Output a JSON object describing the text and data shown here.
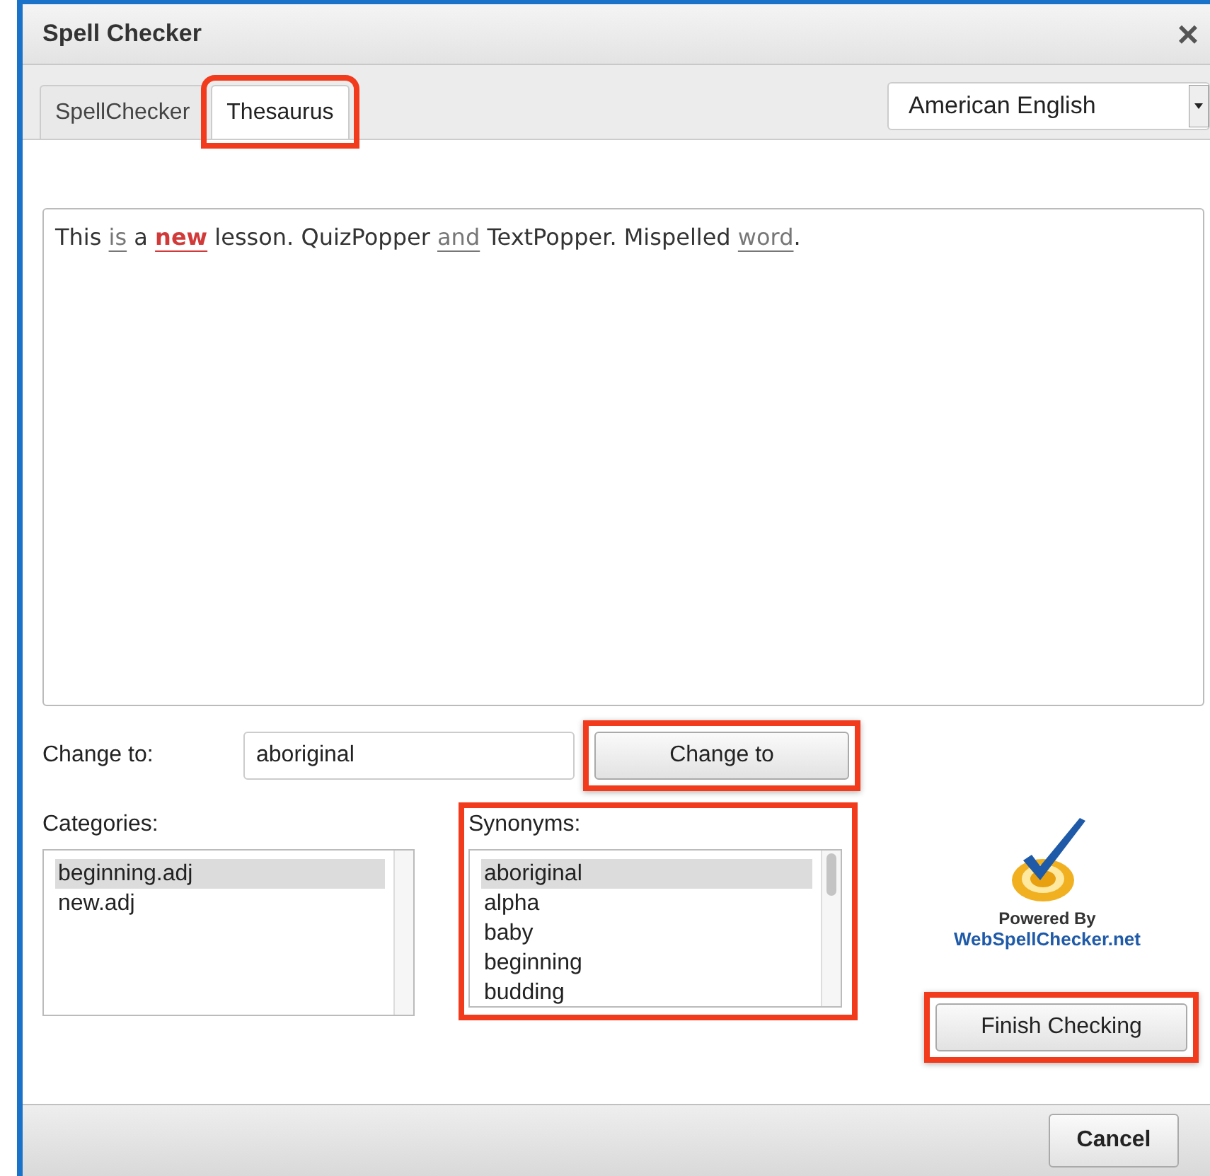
{
  "window": {
    "title": "Spell Checker",
    "close": "×"
  },
  "tabs": [
    {
      "label": "SpellChecker",
      "selected": false,
      "highlighted": false
    },
    {
      "label": "Thesaurus",
      "selected": true,
      "highlighted": true
    }
  ],
  "language_select": {
    "value": "American English"
  },
  "text_area": {
    "segments": [
      {
        "text": "This ",
        "kind": "plain"
      },
      {
        "text": "is",
        "kind": "grammar"
      },
      {
        "text": " a ",
        "kind": "plain"
      },
      {
        "text": "new",
        "kind": "misspelled"
      },
      {
        "text": " lesson. QuizPopper ",
        "kind": "plain"
      },
      {
        "text": "and",
        "kind": "grammar"
      },
      {
        "text": " TextPopper. Mispelled ",
        "kind": "plain"
      },
      {
        "text": "word",
        "kind": "grammar"
      },
      {
        "text": ".",
        "kind": "plain"
      }
    ]
  },
  "change_to": {
    "label": "Change to:",
    "value": "aboriginal",
    "button": "Change to",
    "highlighted": true
  },
  "categories": {
    "label": "Categories:",
    "items": [
      {
        "text": "beginning.adj",
        "selected": true
      },
      {
        "text": "new.adj",
        "selected": false
      }
    ]
  },
  "synonyms": {
    "label": "Synonyms:",
    "highlighted": true,
    "items": [
      {
        "text": "aboriginal",
        "selected": true
      },
      {
        "text": "alpha",
        "selected": false
      },
      {
        "text": "baby",
        "selected": false
      },
      {
        "text": "beginning",
        "selected": false
      },
      {
        "text": "budding",
        "selected": false
      }
    ]
  },
  "logo": {
    "line_1": "Powered By",
    "line_2": "WebSpellChecker.net"
  },
  "finish_button": {
    "label": "Finish Checking",
    "highlighted": true
  },
  "footer": {
    "cancel": "Cancel"
  }
}
